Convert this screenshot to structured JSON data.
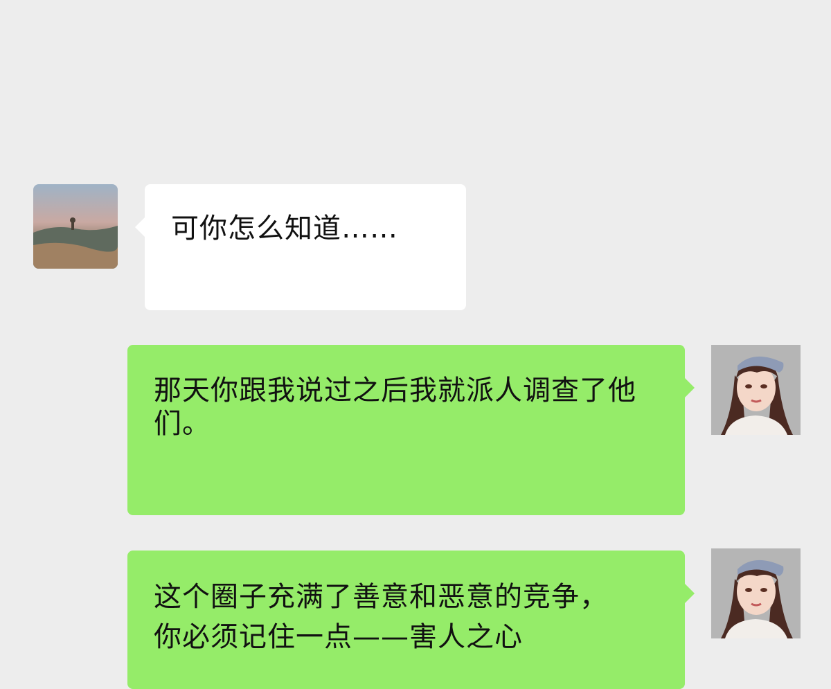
{
  "colors": {
    "background": "#ededed",
    "incoming_bubble": "#ffffff",
    "outgoing_bubble": "#95ec69",
    "text": "#111111"
  },
  "messages": [
    {
      "direction": "incoming",
      "text": "可你怎么知道……"
    },
    {
      "direction": "outgoing",
      "text": "那天你跟我说过之后我就派人调查了他们。"
    },
    {
      "direction": "outgoing",
      "text": "这个圈子充满了善意和恶意的竞争，你必须记住一点——害人之心"
    }
  ]
}
